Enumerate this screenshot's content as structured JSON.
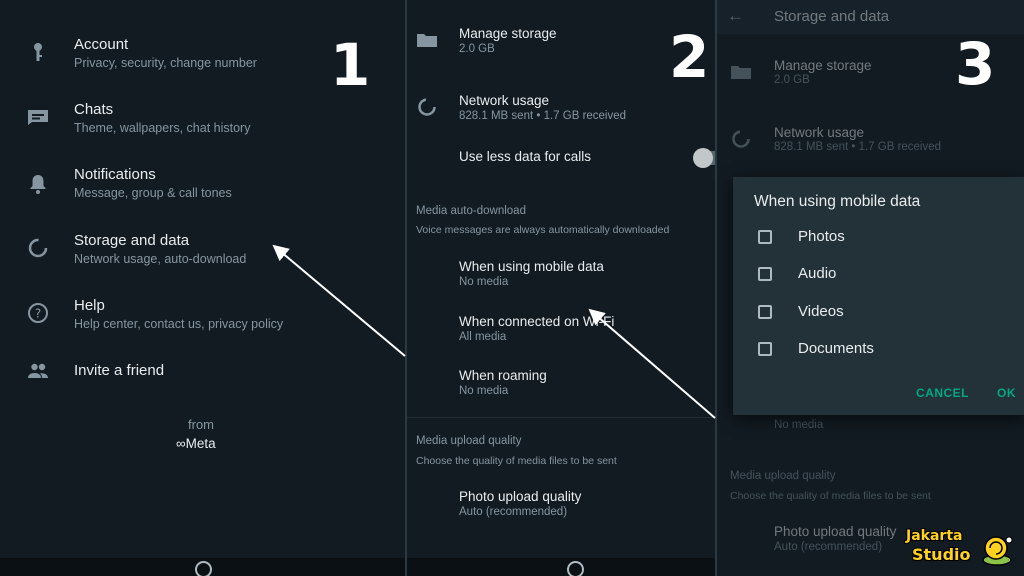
{
  "panel1": {
    "number": "1",
    "items": [
      {
        "title": "Account",
        "subtitle": "Privacy, security, change number",
        "icon": "key-icon"
      },
      {
        "title": "Chats",
        "subtitle": "Theme, wallpapers, chat history",
        "icon": "chat-icon"
      },
      {
        "title": "Notifications",
        "subtitle": "Message, group & call tones",
        "icon": "bell-icon"
      },
      {
        "title": "Storage and data",
        "subtitle": "Network usage, auto-download",
        "icon": "data-usage-icon"
      },
      {
        "title": "Help",
        "subtitle": "Help center, contact us, privacy policy",
        "icon": "help-icon"
      },
      {
        "title": "Invite a friend",
        "subtitle": "",
        "icon": "people-icon"
      }
    ],
    "from_label": "from",
    "meta_label": "Meta"
  },
  "panel2": {
    "number": "2",
    "manage_storage": {
      "title": "Manage storage",
      "subtitle": "2.0 GB"
    },
    "network_usage": {
      "title": "Network usage",
      "subtitle": "828.1 MB sent • 1.7 GB received"
    },
    "less_data": {
      "title": "Use less data for calls"
    },
    "auto_download": {
      "header": "Media auto-download",
      "note": "Voice messages are always automatically downloaded",
      "items": [
        {
          "title": "When using mobile data",
          "subtitle": "No media"
        },
        {
          "title": "When connected on Wi-Fi",
          "subtitle": "All media"
        },
        {
          "title": "When roaming",
          "subtitle": "No media"
        }
      ]
    },
    "upload_quality": {
      "header": "Media upload quality",
      "note": "Choose the quality of media files to be sent",
      "title": "Photo upload quality",
      "subtitle": "Auto (recommended)"
    }
  },
  "panel3": {
    "number": "3",
    "page_title": "Storage and data",
    "manage_storage": {
      "title": "Manage storage",
      "subtitle": "2.0 GB"
    },
    "network_usage": {
      "title": "Network usage",
      "subtitle": "828.1 MB sent • 1.7 GB received"
    },
    "no_media": "No media",
    "upload_header": "Media upload quality",
    "upload_note": "Choose the quality of media files to be sent",
    "photo_title": "Photo upload quality",
    "photo_sub": "Auto (recommended)",
    "dialog": {
      "title": "When using mobile data",
      "options": [
        "Photos",
        "Audio",
        "Videos",
        "Documents"
      ],
      "cancel": "CANCEL",
      "ok": "OK"
    }
  },
  "watermark": {
    "line1": "Jakarta",
    "line2": "Studio"
  },
  "colors": {
    "accent": "#00a884",
    "background": "#121b22",
    "dialog": "#233138"
  }
}
